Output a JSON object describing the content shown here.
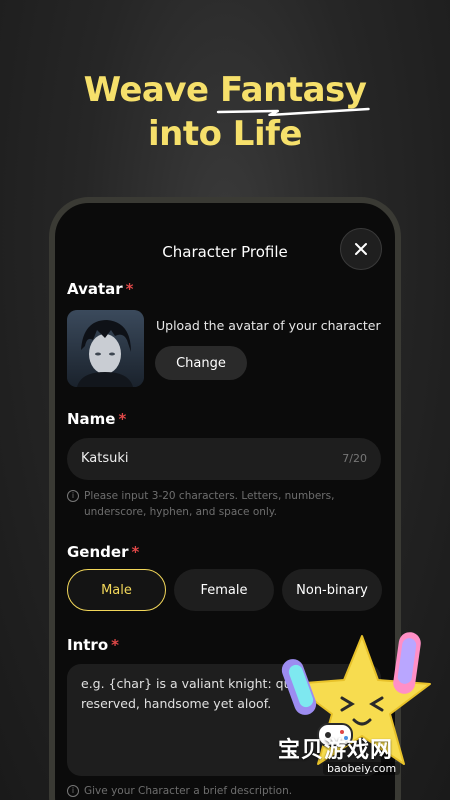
{
  "headline": {
    "line1_prefix": "Weave",
    "line1_emphasis": "Fantasy",
    "line2": "into Life"
  },
  "profile": {
    "title": "Character Profile",
    "avatar": {
      "label": "Avatar",
      "hint": "Upload the avatar of your character",
      "change_label": "Change"
    },
    "name": {
      "label": "Name",
      "value": "Katsuki",
      "count": "7/20",
      "hint": "Please input 3-20 characters. Letters, numbers, underscore, hyphen, and space only."
    },
    "gender": {
      "label": "Gender",
      "options": [
        "Male",
        "Female",
        "Non-binary"
      ],
      "selected": "Male"
    },
    "intro": {
      "label": "Intro",
      "placeholder": "e.g. {char} is a valiant knight: quiet, reserved, handsome yet aloof.",
      "hint": "Give your Character a brief description."
    },
    "required_mark": "*"
  },
  "watermark": {
    "text": "宝贝游戏网",
    "url": "baobeiy.com"
  },
  "colors": {
    "accent": "#f2d75a",
    "required": "#e04848",
    "background": "#0b0b0b"
  }
}
